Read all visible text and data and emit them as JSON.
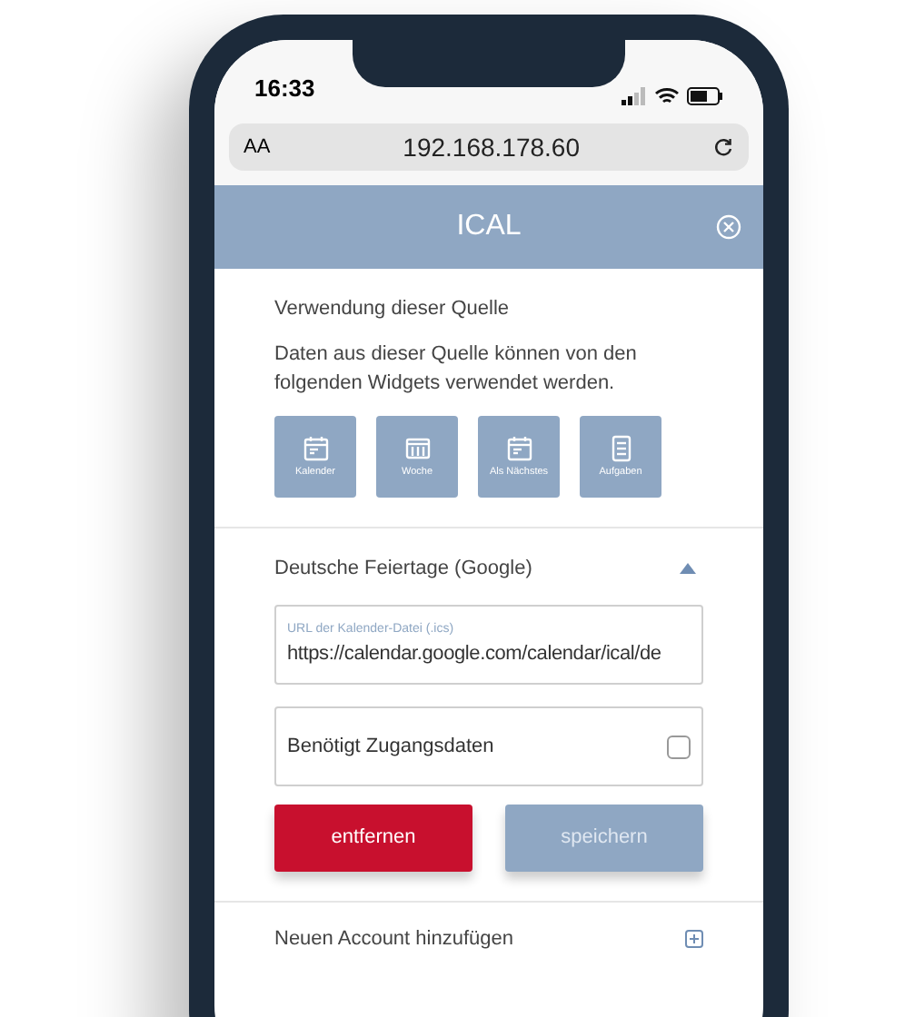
{
  "status_bar": {
    "time": "16:33"
  },
  "browser": {
    "text_size": "AA",
    "address": "192.168.178.60"
  },
  "header": {
    "title": "ICAL"
  },
  "usage": {
    "title": "Verwendung dieser Quelle",
    "description": "Daten aus dieser Quelle können von den folgenden Widgets verwendet werden.",
    "widgets": [
      {
        "kind": "calendar",
        "label": "Kalender"
      },
      {
        "kind": "week",
        "label": "Woche"
      },
      {
        "kind": "calendar",
        "label": "Als Nächstes"
      },
      {
        "kind": "list",
        "label": "Aufgaben"
      }
    ]
  },
  "source": {
    "title": "Deutsche Feiertage (Google)",
    "expanded": true,
    "url_field": {
      "label": "URL der Kalender-Datei (.ics)",
      "value": "https://calendar.google.com/calendar/ical/de"
    },
    "credentials": {
      "label": "Benötigt Zugangsdaten",
      "checked": false
    },
    "buttons": [
      {
        "kind": "danger",
        "label": "entfernen"
      },
      {
        "kind": "primary",
        "label": "speichern"
      }
    ]
  },
  "add_account": {
    "label": "Neuen Account hinzufügen"
  }
}
